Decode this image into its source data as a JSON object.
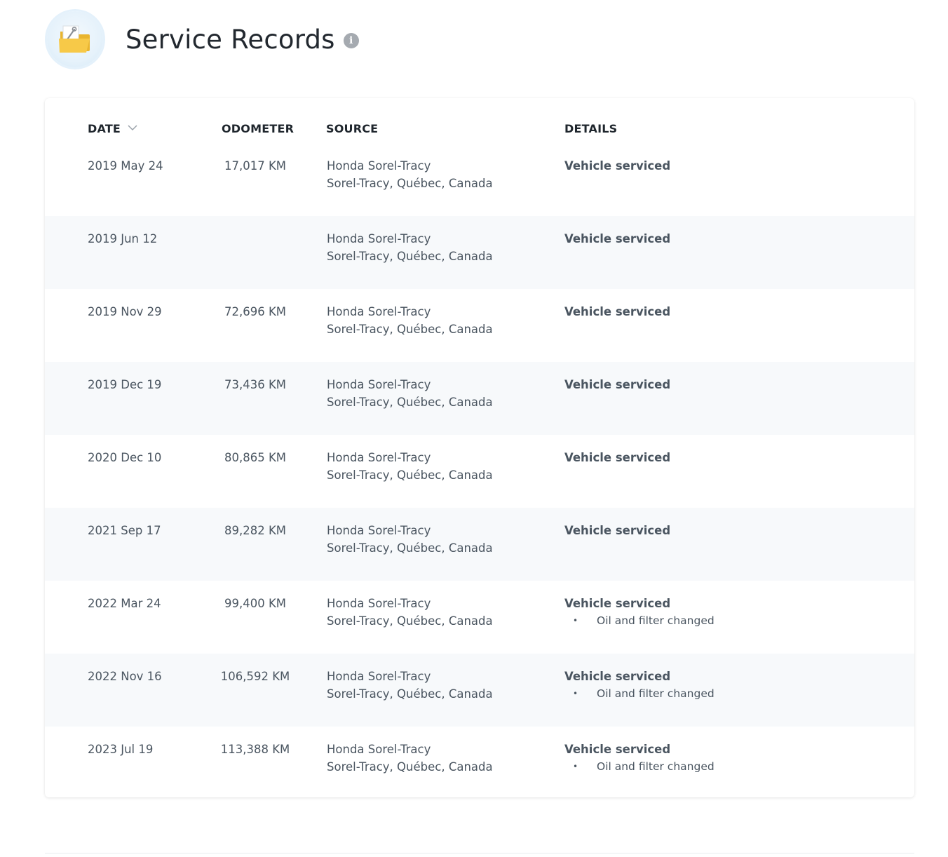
{
  "header": {
    "title": "Service Records",
    "info_icon": "info-icon",
    "folder_icon": "folder-wrench-icon"
  },
  "table": {
    "columns": {
      "date": "DATE",
      "odometer": "ODOMETER",
      "source": "SOURCE",
      "details": "DETAILS"
    },
    "rows": [
      {
        "date": "2019 May 24",
        "odometer": "17,017 KM",
        "source_name": "Honda Sorel-Tracy",
        "source_location": "Sorel-Tracy, Québec, Canada",
        "detail_title": "Vehicle serviced",
        "detail_items": []
      },
      {
        "date": "2019 Jun 12",
        "odometer": "",
        "source_name": "Honda Sorel-Tracy",
        "source_location": "Sorel-Tracy, Québec, Canada",
        "detail_title": "Vehicle serviced",
        "detail_items": []
      },
      {
        "date": "2019 Nov 29",
        "odometer": "72,696 KM",
        "source_name": "Honda Sorel-Tracy",
        "source_location": "Sorel-Tracy, Québec, Canada",
        "detail_title": "Vehicle serviced",
        "detail_items": []
      },
      {
        "date": "2019 Dec 19",
        "odometer": "73,436 KM",
        "source_name": "Honda Sorel-Tracy",
        "source_location": "Sorel-Tracy, Québec, Canada",
        "detail_title": "Vehicle serviced",
        "detail_items": []
      },
      {
        "date": "2020 Dec 10",
        "odometer": "80,865 KM",
        "source_name": "Honda Sorel-Tracy",
        "source_location": "Sorel-Tracy, Québec, Canada",
        "detail_title": "Vehicle serviced",
        "detail_items": []
      },
      {
        "date": "2021 Sep 17",
        "odometer": "89,282 KM",
        "source_name": "Honda Sorel-Tracy",
        "source_location": "Sorel-Tracy, Québec, Canada",
        "detail_title": "Vehicle serviced",
        "detail_items": []
      },
      {
        "date": "2022 Mar 24",
        "odometer": "99,400 KM",
        "source_name": "Honda Sorel-Tracy",
        "source_location": "Sorel-Tracy, Québec, Canada",
        "detail_title": "Vehicle serviced",
        "detail_items": [
          "Oil and filter changed"
        ]
      },
      {
        "date": "2022 Nov 16",
        "odometer": "106,592 KM",
        "source_name": "Honda Sorel-Tracy",
        "source_location": "Sorel-Tracy, Québec, Canada",
        "detail_title": "Vehicle serviced",
        "detail_items": [
          "Oil and filter changed"
        ]
      },
      {
        "date": "2023 Jul 19",
        "odometer": "113,388 KM",
        "source_name": "Honda Sorel-Tracy",
        "source_location": "Sorel-Tracy, Québec, Canada",
        "detail_title": "Vehicle serviced",
        "detail_items": [
          "Oil and filter changed"
        ]
      }
    ]
  },
  "colors": {
    "title": "#22282f",
    "text": "#4a5560",
    "stripe": "#f7f9fb",
    "folder": "#f7c948"
  }
}
